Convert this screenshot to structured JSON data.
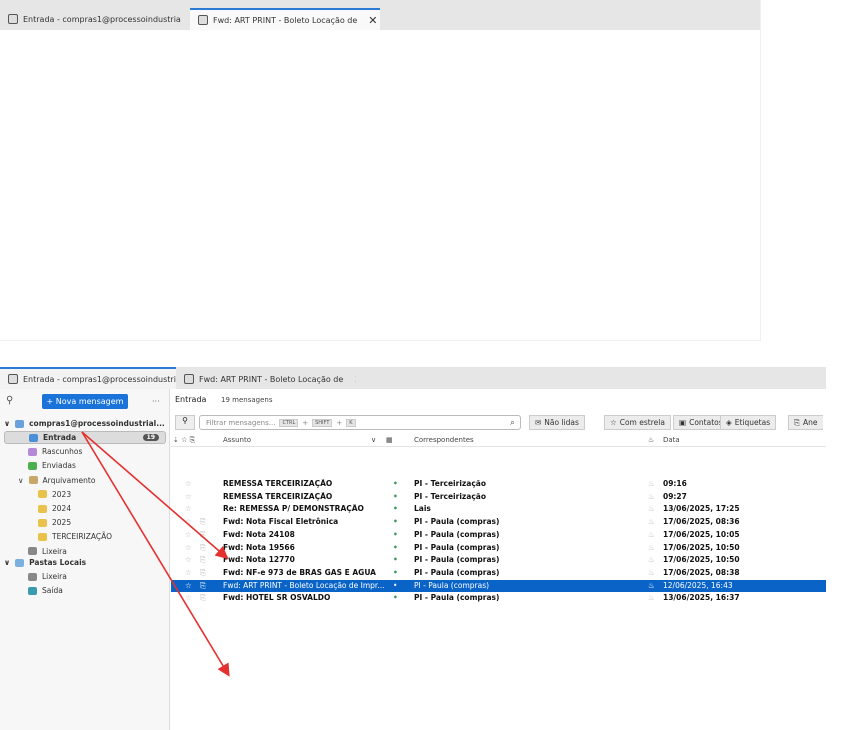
{
  "tabs": [
    {
      "label": "Entrada - compras1@processoindustria"
    },
    {
      "label": "Fwd: ART PRINT - Boleto Locação de"
    }
  ],
  "sidebar": {
    "new_message": "+ Nova mensagem",
    "more": "···",
    "account": "compras1@processoindustrial...",
    "folders": [
      {
        "label": "Entrada",
        "badge": "19",
        "color": "#4a8fd8"
      },
      {
        "label": "Rascunhos",
        "color": "#b58ad6"
      },
      {
        "label": "Enviadas",
        "color": "#4caf50"
      },
      {
        "label": "Arquivamento",
        "color": "#c8a86a"
      },
      {
        "label": "2023",
        "color": "#e8c24a"
      },
      {
        "label": "2024",
        "color": "#e8c24a"
      },
      {
        "label": "2025",
        "color": "#e8c24a"
      },
      {
        "label": "TERCEIRIZAÇÃO",
        "color": "#e8c24a"
      },
      {
        "label": "Lixeira",
        "color": "#888"
      }
    ],
    "local": "Pastas Locais",
    "local_folders": [
      {
        "label": "Lixeira",
        "color": "#888"
      },
      {
        "label": "Saída",
        "color": "#3a9ab0"
      }
    ]
  },
  "main": {
    "folder": "Entrada",
    "count": "19 mensagens",
    "filter_placeholder": "Filtrar mensagens...",
    "kbd": [
      "CTRL",
      "SHIFT",
      "K"
    ],
    "quick_filters": [
      "Não lidas",
      "Com estrela",
      "Contatos",
      "Etiquetas",
      "Ane"
    ],
    "columns": {
      "subject": "Assunto",
      "correspondents": "Correspondentes",
      "date": "Data"
    },
    "messages": [
      {
        "subject": "REMESSA TERCEIRIZAÇÃO",
        "from": "PI - Terceirização",
        "date": "09:16",
        "attach": false
      },
      {
        "subject": "REMESSA TERCEIRIZAÇÃO",
        "from": "PI - Terceirização",
        "date": "09:27",
        "attach": false
      },
      {
        "subject": "Re: REMESSA P/ DEMONSTRAÇÃO",
        "from": "Lais",
        "date": "13/06/2025, 17:25",
        "attach": false
      },
      {
        "subject": "Fwd: Nota Fiscal Eletrônica",
        "from": "PI - Paula (compras)",
        "date": "17/06/2025, 08:36",
        "attach": true
      },
      {
        "subject": "Fwd: Nota 24108",
        "from": "PI - Paula (compras)",
        "date": "17/06/2025, 10:05",
        "attach": true
      },
      {
        "subject": "Fwd: Nota 19566",
        "from": "PI - Paula (compras)",
        "date": "17/06/2025, 10:50",
        "attach": true
      },
      {
        "subject": "Fwd: Nota 12770",
        "from": "PI - Paula (compras)",
        "date": "17/06/2025, 10:50",
        "attach": true
      },
      {
        "subject": "Fwd: NF-e 973 de BRAS GAS E AGUA",
        "from": "PI - Paula (compras)",
        "date": "17/06/2025, 08:38",
        "attach": true
      },
      {
        "subject": "Fwd: ART PRINT - Boleto Locação de Impr...",
        "from": "PI - Paula (compras)",
        "date": "12/06/2025, 16:43",
        "attach": true,
        "selected": true
      },
      {
        "subject": "Fwd: HOTEL SR OSVALDO",
        "from": "PI - Paula (compras)",
        "date": "13/06/2025, 16:37",
        "attach": true
      }
    ]
  },
  "annotation_color": "#e53030"
}
